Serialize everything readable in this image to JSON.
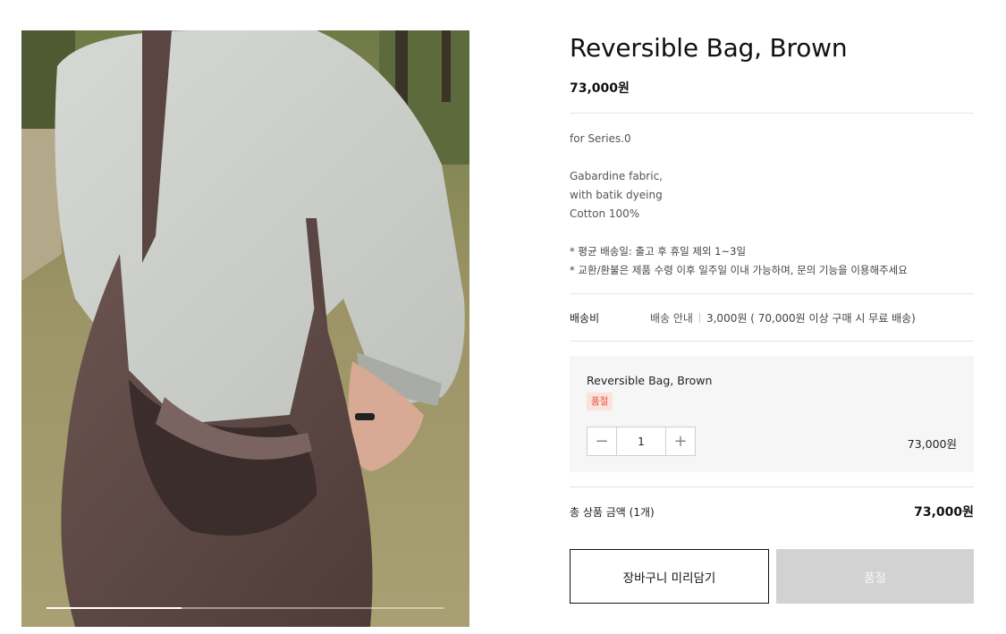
{
  "product": {
    "title": "Reversible Bag, Brown",
    "price": "73,000원",
    "description": {
      "series": "for Series.0",
      "material_lines": [
        "Gabardine fabric,",
        "with batik dyeing",
        "Cotton 100%"
      ],
      "notices": [
        "* 평균 배송일: 출고 후 휴일 제외 1~3일",
        "* 교환/환불은 제품 수령 이후 일주일 이내 가능하며, 문의 기능을 이용해주세요"
      ]
    }
  },
  "shipping": {
    "label": "배송비",
    "guide": "배송 안내",
    "fee": "3,000원 ( 70,000원 이상 구매 시 무료 배송)"
  },
  "option": {
    "name": "Reversible Bag, Brown",
    "badge": "품절",
    "quantity": "1",
    "price": "73,000원",
    "decrease_symbol": "−",
    "increase_symbol": "+"
  },
  "total": {
    "label": "총 상품 금액 (1개)",
    "value": "73,000원"
  },
  "buttons": {
    "cart": "장바구니 미리담기",
    "soldout": "품절"
  },
  "gallery": {
    "progress": 0.34
  },
  "colors": {
    "soldout_badge_text": "#e5533d",
    "soldout_badge_bg": "#fbe2dc",
    "soldout_button_bg": "#d2d2d2"
  }
}
